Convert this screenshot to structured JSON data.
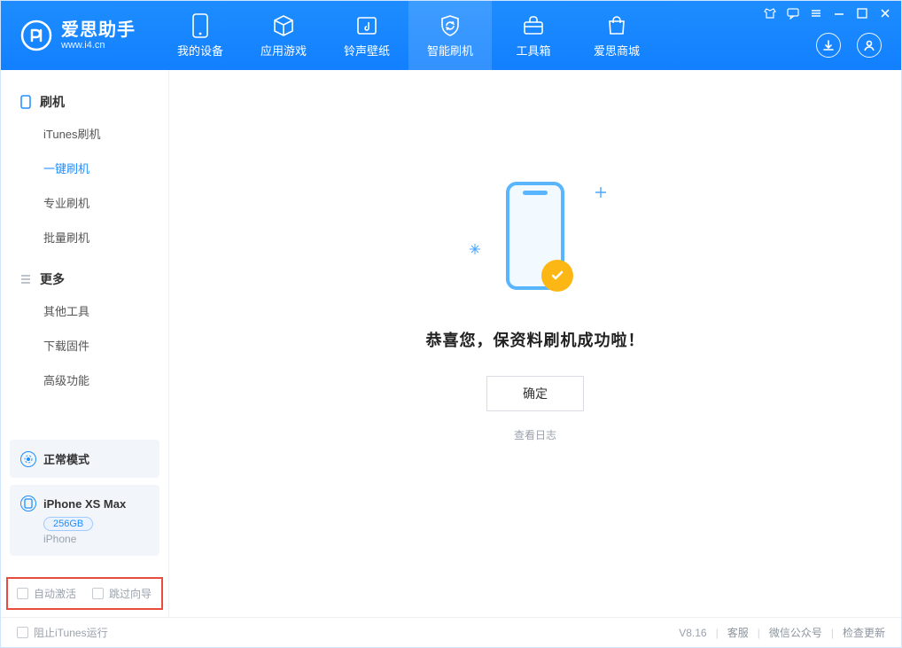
{
  "brand": {
    "title": "爱思助手",
    "sub": "www.i4.cn"
  },
  "tabs": [
    {
      "label": "我的设备",
      "icon": "device"
    },
    {
      "label": "应用游戏",
      "icon": "cube"
    },
    {
      "label": "铃声壁纸",
      "icon": "music"
    },
    {
      "label": "智能刷机",
      "icon": "refresh"
    },
    {
      "label": "工具箱",
      "icon": "toolbox"
    },
    {
      "label": "爱思商城",
      "icon": "bag"
    }
  ],
  "active_tab_index": 3,
  "sidebar": {
    "groups": [
      {
        "title": "刷机",
        "items": [
          "iTunes刷机",
          "一键刷机",
          "专业刷机",
          "批量刷机"
        ],
        "active_index": 1
      },
      {
        "title": "更多",
        "items": [
          "其他工具",
          "下载固件",
          "高级功能"
        ],
        "active_index": -1
      }
    ],
    "mode_card": {
      "label": "正常模式"
    },
    "device_card": {
      "name": "iPhone XS Max",
      "storage": "256GB",
      "type": "iPhone"
    },
    "footer_checks": [
      {
        "label": "自动激活",
        "checked": false
      },
      {
        "label": "跳过向导",
        "checked": false
      }
    ]
  },
  "main": {
    "success_text": "恭喜您，保资料刷机成功啦！",
    "ok_button": "确定",
    "log_link": "查看日志"
  },
  "statusbar": {
    "block_itunes": "阻止iTunes运行",
    "version": "V8.16",
    "links": [
      "客服",
      "微信公众号",
      "检查更新"
    ]
  }
}
